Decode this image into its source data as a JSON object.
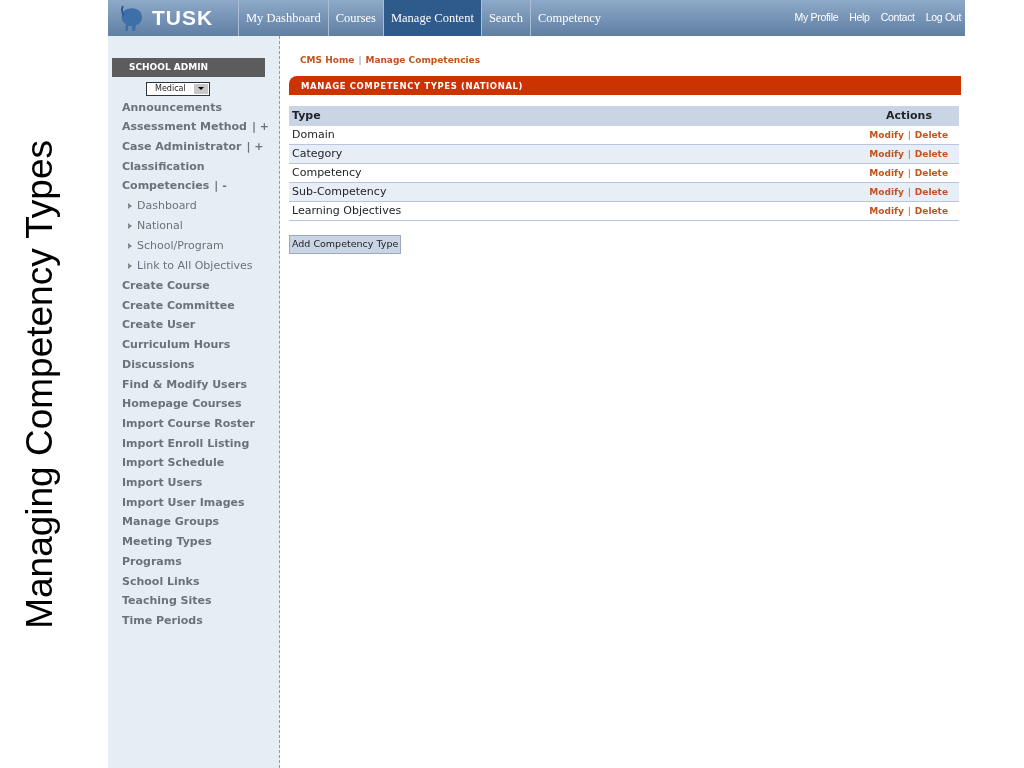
{
  "slide_title": "Managing Competency Types",
  "app": {
    "logo": "TUSK",
    "nav_tabs": [
      {
        "label": "My Dashboard",
        "selected": false
      },
      {
        "label": "Courses",
        "selected": false
      },
      {
        "label": "Manage Content",
        "selected": true
      },
      {
        "label": "Search",
        "selected": false
      },
      {
        "label": "Competency",
        "selected": false
      }
    ],
    "user_links": [
      "My Profile",
      "Help",
      "Contact",
      "Log Out"
    ]
  },
  "sidebar": {
    "heading": "SCHOOL ADMIN",
    "school_select": {
      "value": "Medical"
    },
    "items": [
      {
        "label": "Announcements"
      },
      {
        "label": "Assessment Method",
        "suffix": "| +"
      },
      {
        "label": "Case Administrator",
        "suffix": "| +"
      },
      {
        "label": "Classification"
      },
      {
        "label": "Competencies",
        "suffix": "| -",
        "children": [
          {
            "label": "Dashboard"
          },
          {
            "label": "National"
          },
          {
            "label": "School/Program"
          },
          {
            "label": "Link to All Objectives"
          }
        ]
      },
      {
        "label": "Create Course"
      },
      {
        "label": "Create Committee"
      },
      {
        "label": "Create User"
      },
      {
        "label": "Curriculum Hours"
      },
      {
        "label": "Discussions"
      },
      {
        "label": "Find & Modify Users"
      },
      {
        "label": "Homepage Courses"
      },
      {
        "label": "Import Course Roster"
      },
      {
        "label": "Import Enroll Listing"
      },
      {
        "label": "Import Schedule"
      },
      {
        "label": "Import Users"
      },
      {
        "label": "Import User Images"
      },
      {
        "label": "Manage Groups"
      },
      {
        "label": "Meeting Types"
      },
      {
        "label": "Programs"
      },
      {
        "label": "School Links"
      },
      {
        "label": "Teaching Sites"
      },
      {
        "label": "Time Periods"
      }
    ]
  },
  "breadcrumb": [
    "CMS Home",
    "Manage Competencies"
  ],
  "breadcrumb_separator": "|",
  "section_title": "MANAGE COMPETENCY TYPES (NATIONAL)",
  "table": {
    "columns": [
      "Type",
      "Actions"
    ],
    "rows": [
      {
        "type": "Domain",
        "actions": [
          "Modify",
          "Delete"
        ]
      },
      {
        "type": "Category",
        "actions": [
          "Modify",
          "Delete"
        ]
      },
      {
        "type": "Competency",
        "actions": [
          "Modify",
          "Delete"
        ]
      },
      {
        "type": "Sub-Competency",
        "actions": [
          "Modify",
          "Delete"
        ]
      },
      {
        "type": "Learning Objectives",
        "actions": [
          "Modify",
          "Delete"
        ]
      }
    ],
    "action_separator": "|"
  },
  "add_button": "Add Competency Type"
}
